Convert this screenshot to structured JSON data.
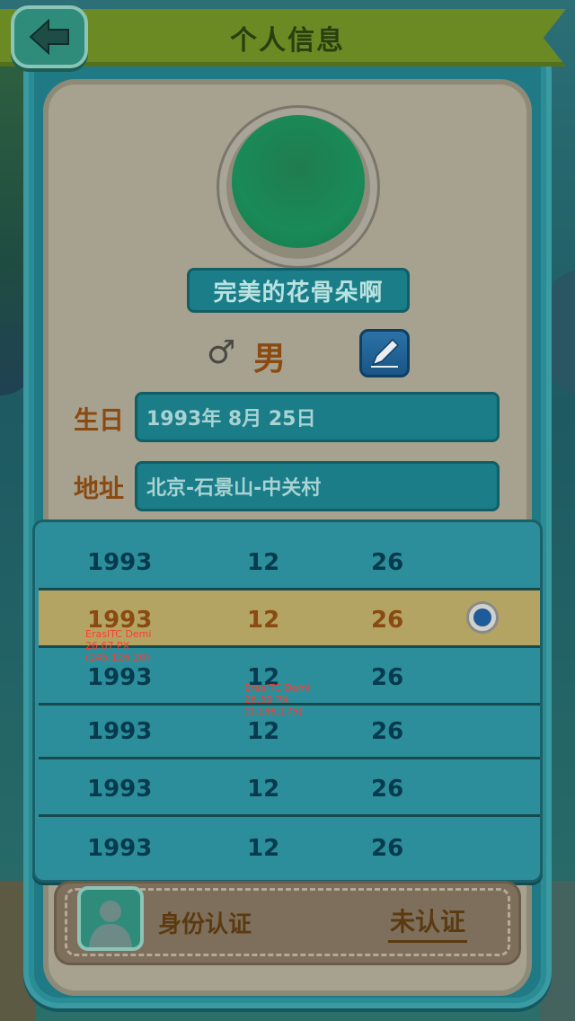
{
  "header": {
    "title": "个人信息",
    "back_icon": "back-arrow-icon"
  },
  "profile": {
    "avatar_color": "#1a8a58",
    "nickname": "完美的花骨朵啊",
    "gender_symbol": "♂",
    "gender_label": "男",
    "edit_icon": "pen-icon"
  },
  "form": {
    "birthday_label": "生日",
    "birthday_value": "1993年 8月 25日",
    "address_label": "地址",
    "address_value": "北京-石景山-中关村"
  },
  "picker": {
    "rows": [
      {
        "year": "1993",
        "month": "12",
        "day": "26",
        "selected": false
      },
      {
        "year": "1993",
        "month": "12",
        "day": "26",
        "selected": true
      },
      {
        "year": "1993",
        "month": "12",
        "day": "26",
        "selected": false
      },
      {
        "year": "1993",
        "month": "12",
        "day": "26",
        "selected": false
      },
      {
        "year": "1993",
        "month": "12",
        "day": "26",
        "selected": false
      },
      {
        "year": "1993",
        "month": "12",
        "day": "26",
        "selected": false
      }
    ]
  },
  "annotations": [
    {
      "font": "ErasITC Demi",
      "size": "26.67 PX",
      "rgb": "(245,126,20)"
    },
    {
      "font": "ErasITC Demi",
      "size": "26.59 PX",
      "rgb": "(0,136,175)"
    }
  ],
  "identity": {
    "label": "身份认证",
    "status": "未认证",
    "icon": "user-silhouette-icon"
  },
  "colors": {
    "accent_orange": "#8a4a12",
    "field_teal": "#1a7d88",
    "header_green": "#6c8a24"
  }
}
